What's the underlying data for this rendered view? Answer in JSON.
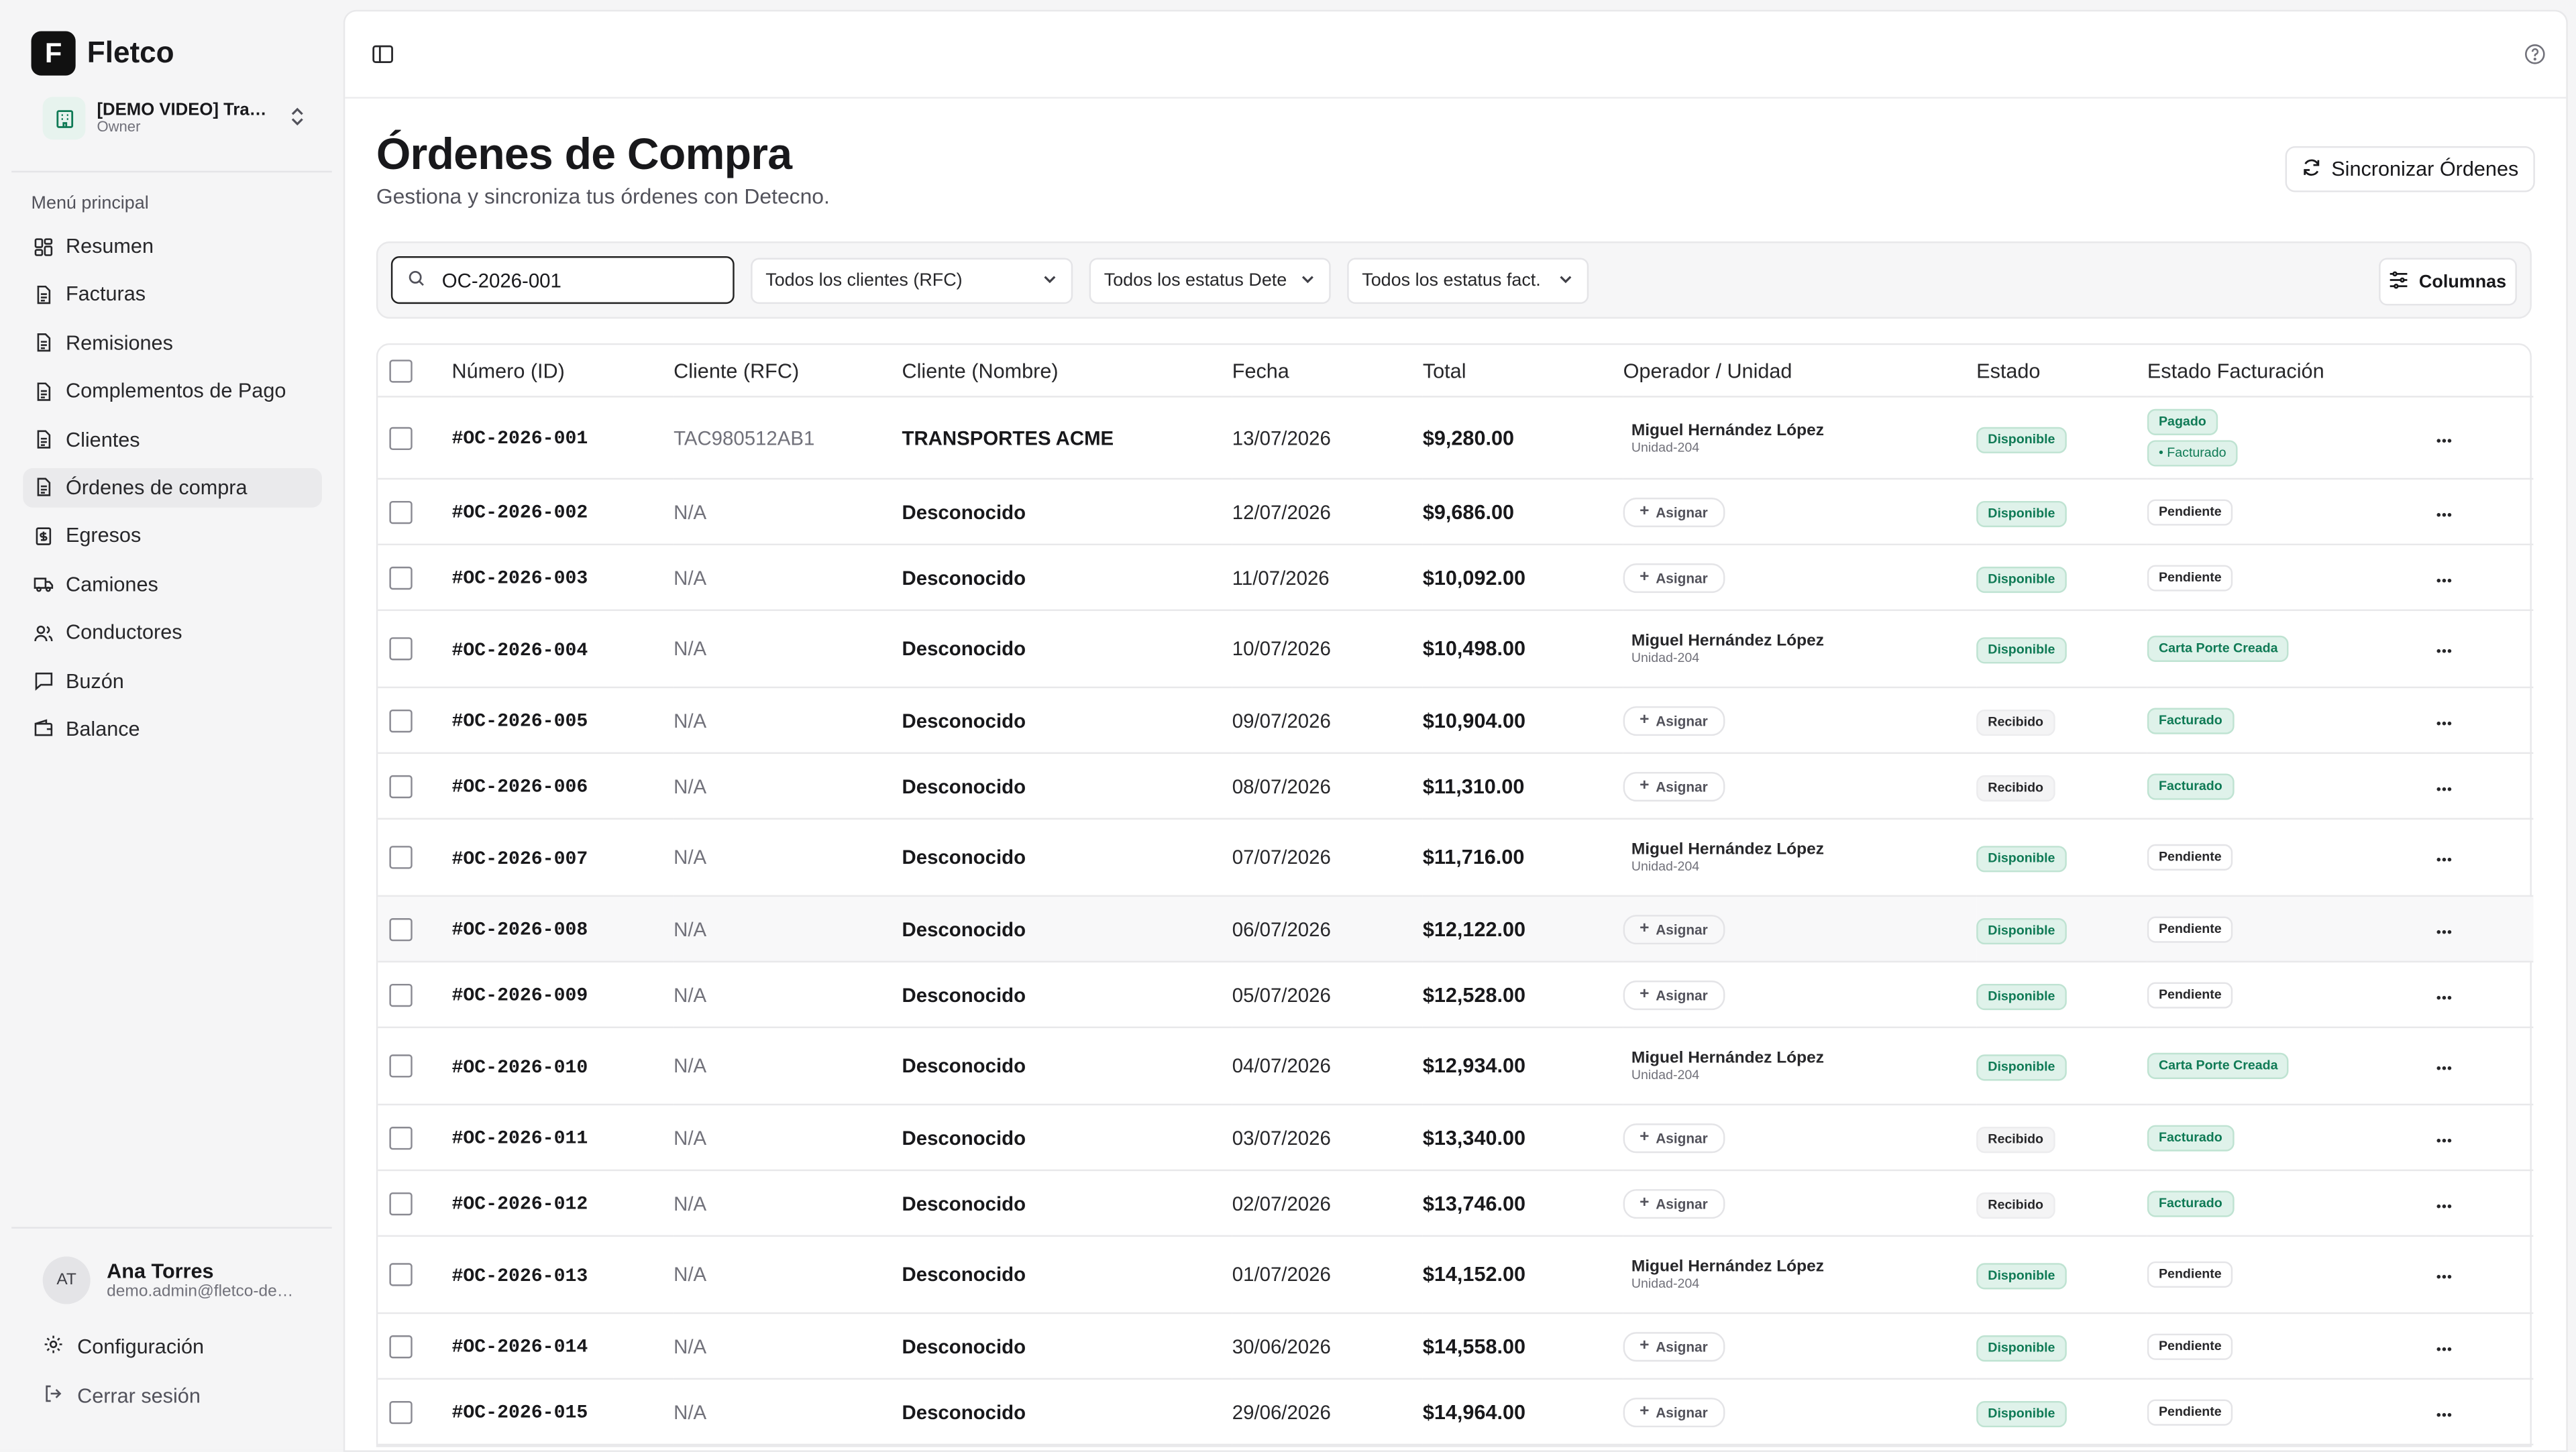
{
  "brand": {
    "logo_letter": "F",
    "name": "Fletco"
  },
  "org": {
    "name": "[DEMO VIDEO] Transportes",
    "role": "Owner"
  },
  "sidebar": {
    "menu_title": "Menú principal",
    "items": [
      {
        "label": "Resumen",
        "icon": "dashboard-icon"
      },
      {
        "label": "Facturas",
        "icon": "document-icon"
      },
      {
        "label": "Remisiones",
        "icon": "document-icon"
      },
      {
        "label": "Complementos de Pago",
        "icon": "document-icon"
      },
      {
        "label": "Clientes",
        "icon": "document-icon"
      },
      {
        "label": "Órdenes de compra",
        "icon": "document-icon",
        "active": true
      },
      {
        "label": "Egresos",
        "icon": "receipt-icon"
      },
      {
        "label": "Camiones",
        "icon": "truck-icon"
      },
      {
        "label": "Conductores",
        "icon": "users-icon"
      },
      {
        "label": "Buzón",
        "icon": "message-icon"
      },
      {
        "label": "Balance",
        "icon": "wallet-icon"
      }
    ]
  },
  "user": {
    "initials": "AT",
    "name": "Ana Torres",
    "email": "demo.admin@fletco-demo.com"
  },
  "footer": {
    "settings_label": "Configuración",
    "logout_label": "Cerrar sesión"
  },
  "page": {
    "title": "Órdenes de Compra",
    "subtitle": "Gestiona y sincroniza tus órdenes con Detecno.",
    "sync_button": "Sincronizar Órdenes"
  },
  "filters": {
    "search_value": "OC-2026-001",
    "client_select": "Todos los clientes (RFC)",
    "status_select": "Todos los estatus Dete",
    "billing_select": "Todos los estatus fact.",
    "columns_button": "Columnas"
  },
  "table": {
    "headers": [
      "Número (ID)",
      "Cliente (RFC)",
      "Cliente (Nombre)",
      "Fecha",
      "Total",
      "Operador / Unidad",
      "Estado",
      "Estado Facturación"
    ],
    "assign_label": "Asignar",
    "rows": [
      {
        "id": "#OC-2026-001",
        "rfc": "TAC980512AB1",
        "name": "TRANSPORTES ACME",
        "date": "13/07/2026",
        "total": "$9,280.00",
        "operator": "Miguel Hernández López",
        "unit": "Unidad-204",
        "status": "Disponible",
        "billing": [
          "Pagado",
          "• Facturado"
        ]
      },
      {
        "id": "#OC-2026-002",
        "rfc": "N/A",
        "name": "Desconocido",
        "date": "12/07/2026",
        "total": "$9,686.00",
        "operator": "",
        "unit": "",
        "status": "Disponible",
        "billing": [
          "Pendiente"
        ]
      },
      {
        "id": "#OC-2026-003",
        "rfc": "N/A",
        "name": "Desconocido",
        "date": "11/07/2026",
        "total": "$10,092.00",
        "operator": "",
        "unit": "",
        "status": "Disponible",
        "billing": [
          "Pendiente"
        ]
      },
      {
        "id": "#OC-2026-004",
        "rfc": "N/A",
        "name": "Desconocido",
        "date": "10/07/2026",
        "total": "$10,498.00",
        "operator": "Miguel Hernández López",
        "unit": "Unidad-204",
        "status": "Disponible",
        "billing": [
          "Carta Porte Creada"
        ]
      },
      {
        "id": "#OC-2026-005",
        "rfc": "N/A",
        "name": "Desconocido",
        "date": "09/07/2026",
        "total": "$10,904.00",
        "operator": "",
        "unit": "",
        "status": "Recibido",
        "billing": [
          "Facturado"
        ]
      },
      {
        "id": "#OC-2026-006",
        "rfc": "N/A",
        "name": "Desconocido",
        "date": "08/07/2026",
        "total": "$11,310.00",
        "operator": "",
        "unit": "",
        "status": "Recibido",
        "billing": [
          "Facturado"
        ]
      },
      {
        "id": "#OC-2026-007",
        "rfc": "N/A",
        "name": "Desconocido",
        "date": "07/07/2026",
        "total": "$11,716.00",
        "operator": "Miguel Hernández López",
        "unit": "Unidad-204",
        "status": "Disponible",
        "billing": [
          "Pendiente"
        ]
      },
      {
        "id": "#OC-2026-008",
        "rfc": "N/A",
        "name": "Desconocido",
        "date": "06/07/2026",
        "total": "$12,122.00",
        "operator": "",
        "unit": "",
        "status": "Disponible",
        "billing": [
          "Pendiente"
        ]
      },
      {
        "id": "#OC-2026-009",
        "rfc": "N/A",
        "name": "Desconocido",
        "date": "05/07/2026",
        "total": "$12,528.00",
        "operator": "",
        "unit": "",
        "status": "Disponible",
        "billing": [
          "Pendiente"
        ]
      },
      {
        "id": "#OC-2026-010",
        "rfc": "N/A",
        "name": "Desconocido",
        "date": "04/07/2026",
        "total": "$12,934.00",
        "operator": "Miguel Hernández López",
        "unit": "Unidad-204",
        "status": "Disponible",
        "billing": [
          "Carta Porte Creada"
        ]
      },
      {
        "id": "#OC-2026-011",
        "rfc": "N/A",
        "name": "Desconocido",
        "date": "03/07/2026",
        "total": "$13,340.00",
        "operator": "",
        "unit": "",
        "status": "Recibido",
        "billing": [
          "Facturado"
        ]
      },
      {
        "id": "#OC-2026-012",
        "rfc": "N/A",
        "name": "Desconocido",
        "date": "02/07/2026",
        "total": "$13,746.00",
        "operator": "",
        "unit": "",
        "status": "Recibido",
        "billing": [
          "Facturado"
        ]
      },
      {
        "id": "#OC-2026-013",
        "rfc": "N/A",
        "name": "Desconocido",
        "date": "01/07/2026",
        "total": "$14,152.00",
        "operator": "Miguel Hernández López",
        "unit": "Unidad-204",
        "status": "Disponible",
        "billing": [
          "Pendiente"
        ]
      },
      {
        "id": "#OC-2026-014",
        "rfc": "N/A",
        "name": "Desconocido",
        "date": "30/06/2026",
        "total": "$14,558.00",
        "operator": "",
        "unit": "",
        "status": "Disponible",
        "billing": [
          "Pendiente"
        ]
      },
      {
        "id": "#OC-2026-015",
        "rfc": "N/A",
        "name": "Desconocido",
        "date": "29/06/2026",
        "total": "$14,964.00",
        "operator": "",
        "unit": "",
        "status": "Disponible",
        "billing": [
          "Pendiente"
        ]
      }
    ]
  },
  "colors": {
    "accent_green": "#0f7a55",
    "badge_green_bg": "#dff2ea"
  }
}
